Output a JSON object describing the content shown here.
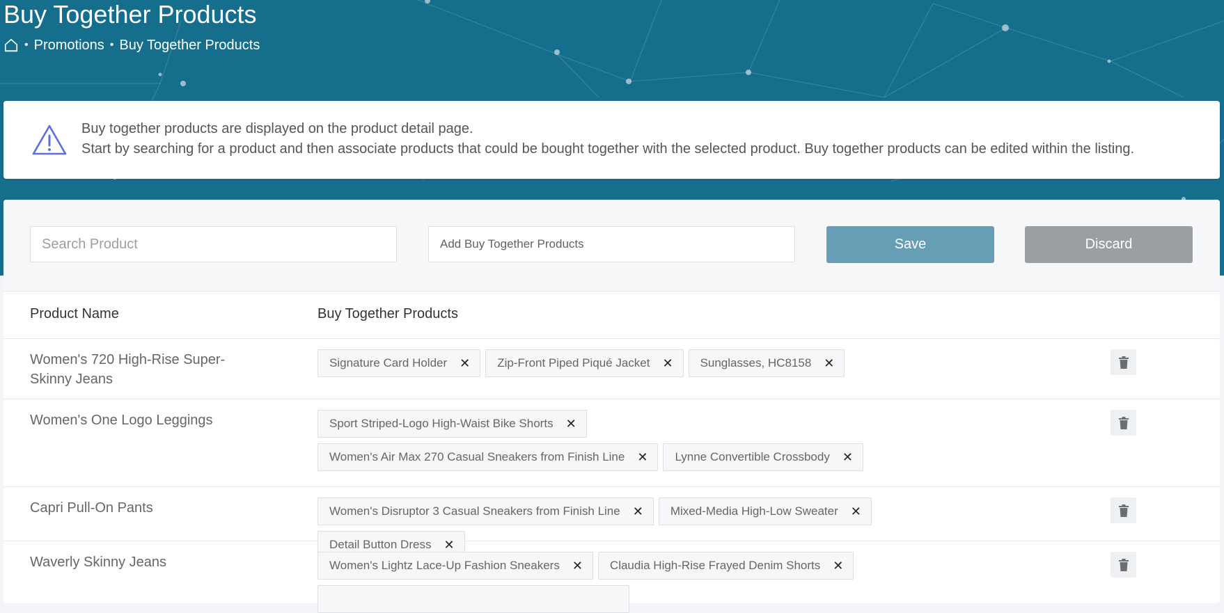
{
  "header": {
    "title": "Buy Together Products",
    "breadcrumb": {
      "sep1": "•",
      "promotions": "Promotions",
      "sep2": "•",
      "current": "Buy Together Products"
    }
  },
  "info": {
    "line1": "Buy together products are displayed on the product detail page.",
    "line2": "Start by searching for a product and then associate products that could be bought together with the selected product. Buy together products can be edited within the listing."
  },
  "toolbar": {
    "search_placeholder": "Search Product",
    "add_placeholder": "Add Buy Together Products",
    "save_label": "Save",
    "discard_label": "Discard"
  },
  "table": {
    "headers": [
      "Product Name",
      "Buy Together Products"
    ],
    "rows": [
      {
        "name": "Women's 720 High-Rise Super-Skinny Jeans",
        "tags": [
          "Signature Card Holder",
          "Zip-Front Piped Piqué Jacket",
          "Sunglasses, HC8158"
        ]
      },
      {
        "name": "Women's One Logo Leggings",
        "tags": [
          "Sport Striped-Logo High-Waist Bike Shorts",
          "Women's Air Max 270 Casual Sneakers from Finish Line",
          "Lynne Convertible Crossbody"
        ]
      },
      {
        "name": "Capri Pull-On Pants",
        "tags": [
          "Women's Disruptor 3 Casual Sneakers from Finish Line",
          "Mixed-Media High-Low Sweater",
          "Detail Button Dress"
        ]
      },
      {
        "name": "Waverly Skinny Jeans",
        "tags": [
          "Women's Lightz Lace-Up Fashion Sneakers",
          "Claudia High-Rise Frayed Denim Shorts"
        ]
      }
    ]
  },
  "icons": {
    "home": "home-icon",
    "warning": "warning-triangle-icon",
    "remove": "close-icon",
    "delete": "trash-icon"
  },
  "colors": {
    "header_bg": "#146e8c",
    "save": "#669fb5",
    "discard": "#9b9ea2",
    "warning_icon": "#5b6ee1"
  }
}
